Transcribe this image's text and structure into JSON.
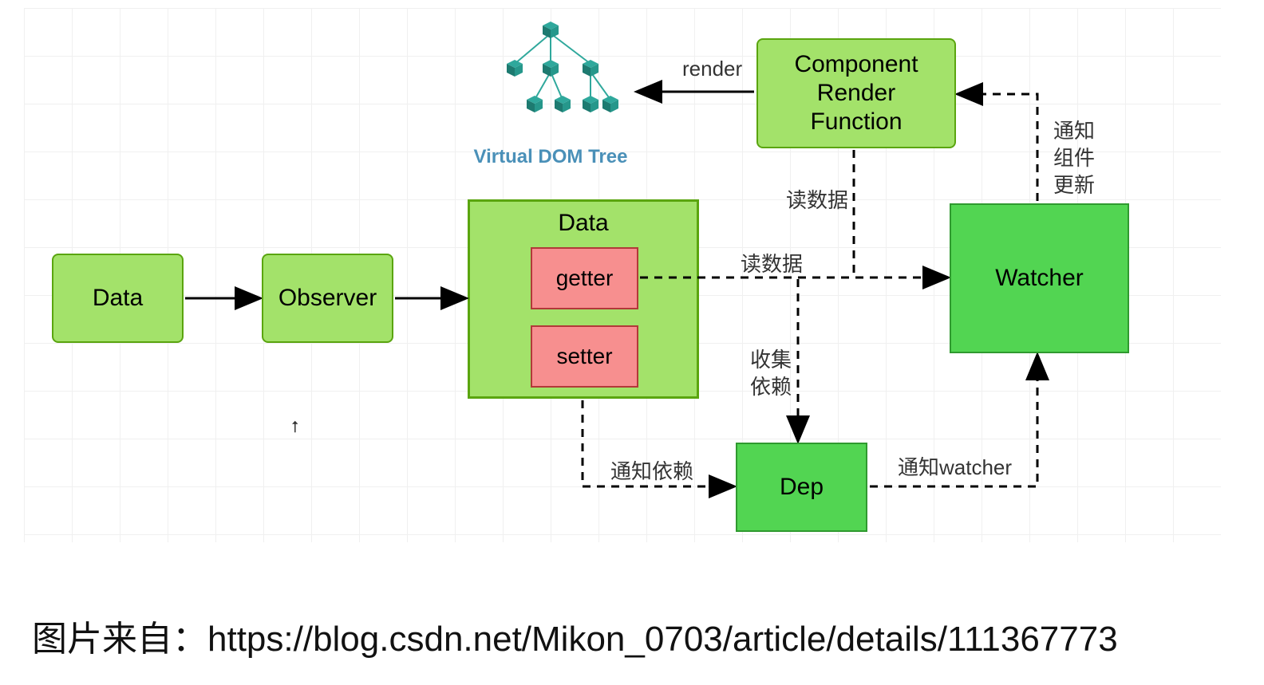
{
  "boxes": {
    "data1": "Data",
    "observer": "Observer",
    "data2_title": "Data",
    "getter": "getter",
    "setter": "setter",
    "crf_line1": "Component",
    "crf_line2": "Render",
    "crf_line3": "Function",
    "watcher": "Watcher",
    "dep": "Dep"
  },
  "labels": {
    "render": "render",
    "read_data_top": "读数据",
    "read_data_mid": "读数据",
    "collect_dep": "收集\n依赖",
    "notify_dep": "通知依赖",
    "notify_watcher": "通知watcher",
    "notify_comp": "通知\n组件\n更新"
  },
  "vdom": {
    "caption": "Virtual DOM Tree"
  },
  "credit": {
    "prefix": "图片来自：",
    "url": "https://blog.csdn.net/Mikon_0703/article/details/111367773"
  },
  "colors": {
    "light_green": "#a3e26a",
    "bright_green": "#52d552",
    "red": "#f78f8f",
    "teal": "#2fa89c"
  }
}
